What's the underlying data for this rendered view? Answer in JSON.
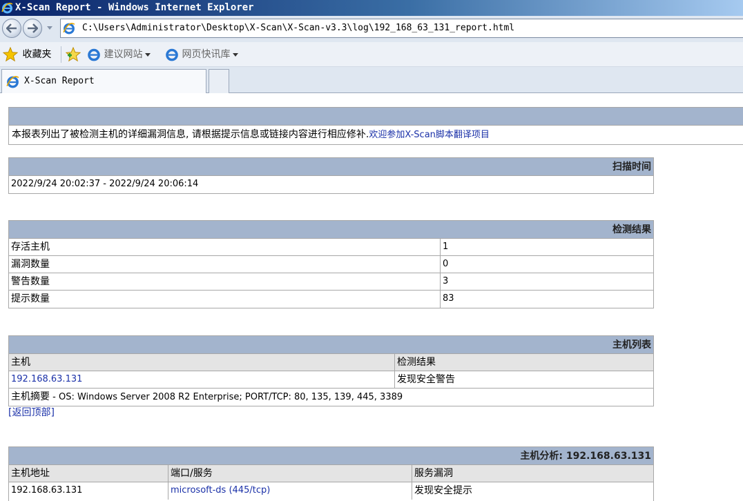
{
  "window": {
    "title": "X-Scan Report - Windows Internet Explorer",
    "address": "C:\\Users\\Administrator\\Desktop\\X-Scan\\X-Scan-v3.3\\log\\192_168_63_131_report.html"
  },
  "favorites_bar": {
    "favorites_label": "收藏夹",
    "suggested_sites": "建议网站",
    "web_slice_gallery": "网页快讯库"
  },
  "tab": {
    "label": "X-Scan Report"
  },
  "report": {
    "intro": {
      "text": "本报表列出了被检测主机的详细漏洞信息, 请根据提示信息或链接内容进行相应修补.",
      "link": "欢迎参加X-Scan脚本翻译项目"
    },
    "scan_time": {
      "header": "扫描时间",
      "value": "2022/9/24 20:02:37 - 2022/9/24 20:06:14"
    },
    "results": {
      "header": "检测结果",
      "rows": [
        {
          "label": "存活主机",
          "value": "1"
        },
        {
          "label": "漏洞数量",
          "value": "0"
        },
        {
          "label": "警告数量",
          "value": "3"
        },
        {
          "label": "提示数量",
          "value": "83"
        }
      ]
    },
    "host_list": {
      "header": "主机列表",
      "col_host": "主机",
      "col_result": "检测结果",
      "host": "192.168.63.131",
      "result": "发现安全警告",
      "summary_label": "主机摘要",
      "summary_value": " - OS: Windows Server 2008 R2 Enterprise; PORT/TCP: 80, 135, 139, 445, 3389"
    },
    "back_to_top": "[返回顶部]",
    "host_analysis": {
      "header": "主机分析: 192.168.63.131",
      "col_address": "主机地址",
      "col_port": "端口/服务",
      "col_vuln": "服务漏洞",
      "address": "192.168.63.131",
      "port": "microsoft-ds (445/tcp)",
      "vuln": "发现安全提示"
    }
  }
}
